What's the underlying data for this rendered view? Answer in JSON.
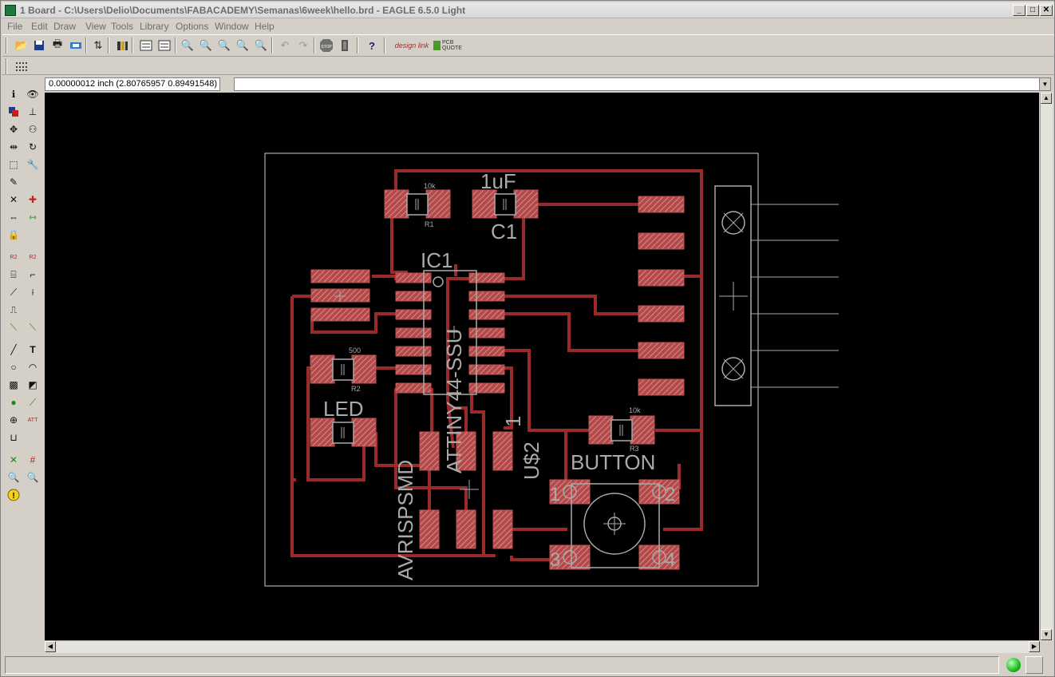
{
  "window": {
    "title": "1 Board - C:\\Users\\Delio\\Documents\\FABACADEMY\\Semanas\\6week\\hello.brd - EAGLE 6.5.0 Light",
    "minimize_label": "_",
    "maximize_label": "□",
    "close_label": "✕"
  },
  "menu": {
    "items": [
      "File",
      "Edit",
      "Draw",
      "View",
      "Tools",
      "Library",
      "Options",
      "Window",
      "Help"
    ]
  },
  "toolbar": {
    "designlink_label": "design link",
    "pcbquote_label": "PCB QUOTE",
    "stop_label": "STOP",
    "help_label": "?"
  },
  "command": {
    "coordinates": "0.00000012 inch (2.80765957 0.89491548)",
    "input_value": ""
  },
  "board": {
    "labels": {
      "r1_value": "10k",
      "r1_name": "R1",
      "c1_value": "1uF",
      "c1_name": "C1",
      "ic1_name": "IC1",
      "ic1_value": "ATTINY44-SSU",
      "r2_value": "500",
      "r2_name": "R2",
      "led_name": "LED",
      "r3_value": "10k",
      "r3_name": "R3",
      "button_name": "BUTTON",
      "header_name": "AVRISPSMD",
      "u2_name": "U$2",
      "u2_pin": "1",
      "btn_pin1": "1",
      "btn_pin2": "2",
      "btn_pin3": "3",
      "btn_pin4": "4"
    },
    "colors": {
      "copper": "#9b2b2b",
      "pad_fill": "#c05050",
      "silkscreen": "#aaaaaa",
      "outline": "#cfcfcf",
      "background": "#000000"
    }
  },
  "status": {
    "message": "",
    "indicator": "green-led"
  }
}
